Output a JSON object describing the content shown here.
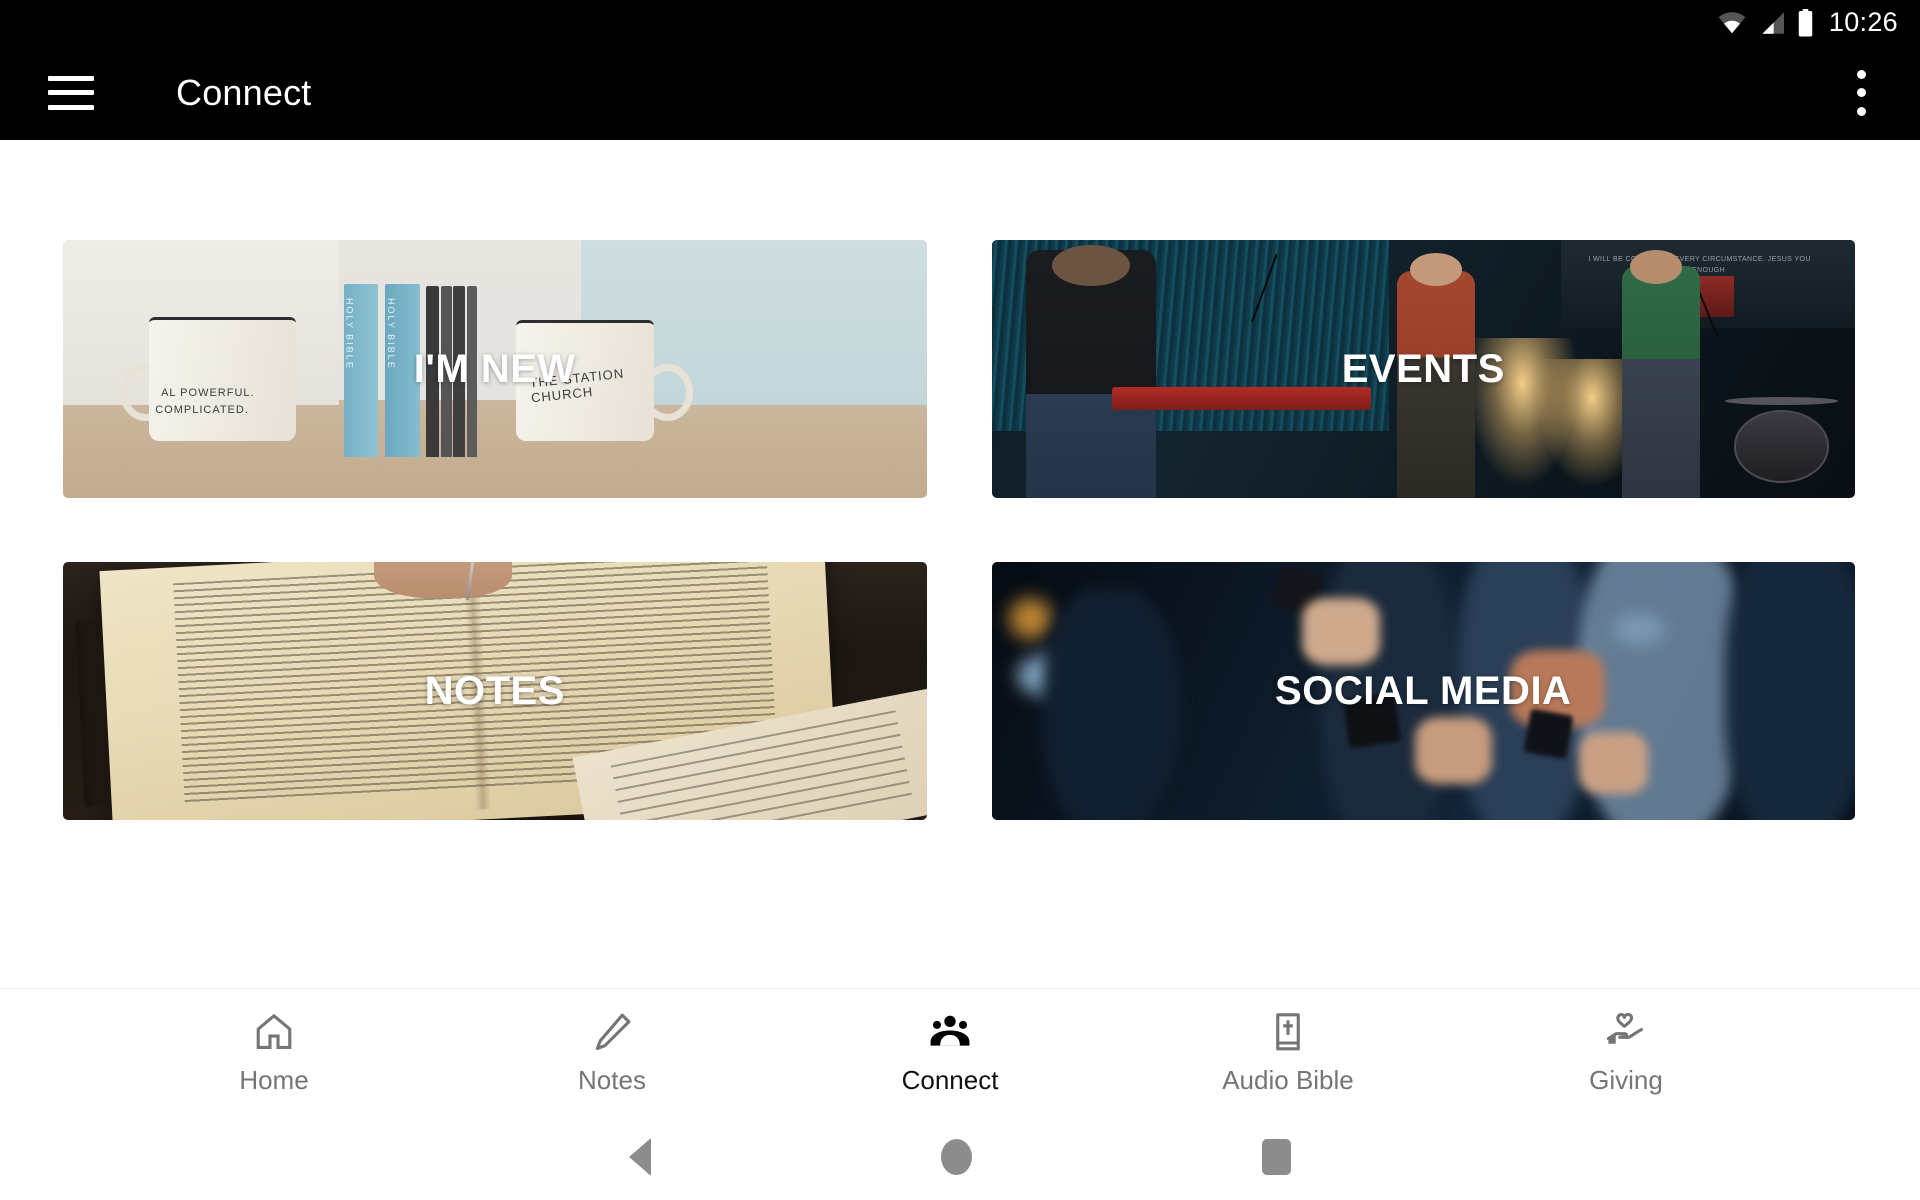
{
  "status_bar": {
    "time": "10:26",
    "icons": [
      "wifi-icon",
      "cellular-signal-icon",
      "battery-icon"
    ],
    "background_color": "#000000"
  },
  "app_bar": {
    "menu_icon": "hamburger-menu-icon",
    "title": "Connect",
    "overflow_icon": "more-vert-icon",
    "background_color": "#000000",
    "text_color": "#ffffff"
  },
  "main": {
    "cards": [
      {
        "label": "I'M NEW",
        "art": "mugs-and-bibles-photo",
        "art_details": {
          "mug_line_1": "AL POWERFUL.",
          "mug_line_2": "COMPLICATED.",
          "book_spine": "HOLY BIBLE",
          "mug_brand": "THE STATION CHURCH"
        }
      },
      {
        "label": "EVENTS",
        "art": "worship-band-stage-photo",
        "art_details": {
          "screen_lyric": "I WILL BE CONTENT IN EVERY CIRCUMSTANCE. JESUS YOU ARE ENOUGH"
        }
      },
      {
        "label": "NOTES",
        "art": "open-bible-with-pen-photo",
        "art_details": {}
      },
      {
        "label": "SOCIAL MEDIA",
        "art": "crowd-holding-phones-photo",
        "art_details": {}
      }
    ],
    "label_color": "#ffffff"
  },
  "tab_bar": {
    "background_color": "#ffffff",
    "active_color": "#111111",
    "inactive_color": "#757575",
    "items": [
      {
        "label": "Home",
        "icon": "home-icon",
        "active": false
      },
      {
        "label": "Notes",
        "icon": "pencil-icon",
        "active": false
      },
      {
        "label": "Connect",
        "icon": "people-group-icon",
        "active": true
      },
      {
        "label": "Audio Bible",
        "icon": "bible-book-icon",
        "active": false
      },
      {
        "label": "Giving",
        "icon": "hand-heart-icon",
        "active": false
      }
    ]
  },
  "system_nav": {
    "back": "back-triangle-icon",
    "home": "home-circle-icon",
    "recents": "recents-square-icon",
    "color": "#8c8c8c"
  }
}
